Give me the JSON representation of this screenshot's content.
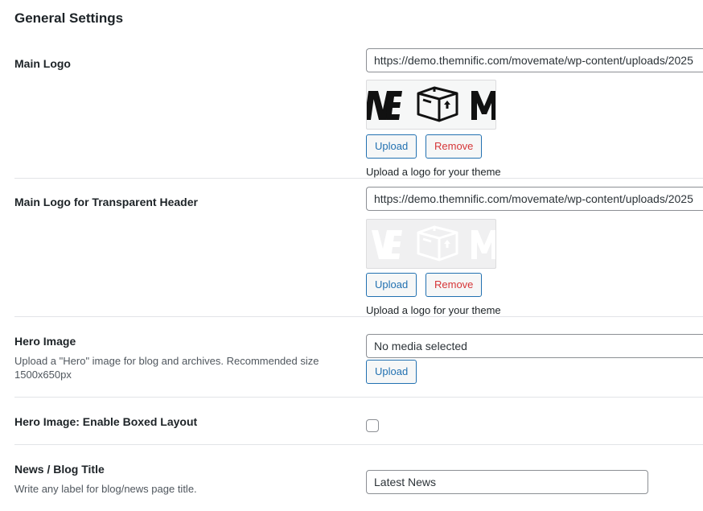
{
  "section_title": "General Settings",
  "main_logo": {
    "label": "Main Logo",
    "url_value": "https://demo.themnific.com/movemate/wp-content/uploads/2025",
    "upload_label": "Upload",
    "remove_label": "Remove",
    "help": "Upload a logo for your theme"
  },
  "transparent_logo": {
    "label": "Main Logo for Transparent Header",
    "url_value": "https://demo.themnific.com/movemate/wp-content/uploads/2025",
    "upload_label": "Upload",
    "remove_label": "Remove",
    "help": "Upload a logo for your theme"
  },
  "hero_image": {
    "label": "Hero Image",
    "description": "Upload a \"Hero\" image for blog and archives. Recommended size 1500x650px",
    "value": "No media selected",
    "upload_label": "Upload"
  },
  "hero_boxed": {
    "label": "Hero Image: Enable Boxed Layout",
    "checked": false
  },
  "blog_title": {
    "label": "News / Blog Title",
    "description": "Write any label for blog/news page title.",
    "value": "Latest News"
  },
  "colors": {
    "accent": "#2271b1",
    "danger": "#d63638",
    "separator": "#e2e4e7"
  }
}
